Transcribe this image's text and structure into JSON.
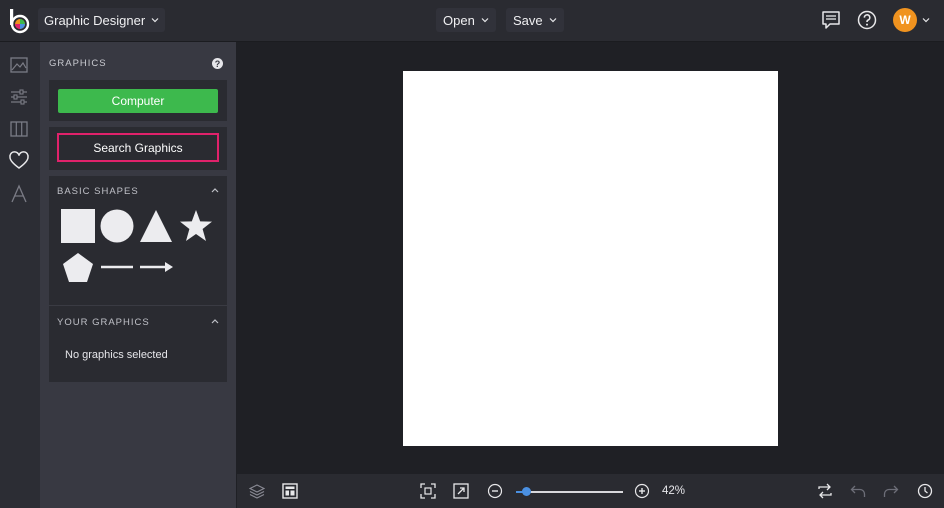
{
  "topbar": {
    "app_switcher_label": "Graphic Designer",
    "open_label": "Open",
    "save_label": "Save",
    "avatar_initial": "W"
  },
  "rail": {
    "items": [
      "image-icon",
      "sliders-icon",
      "columns-icon",
      "heart-icon",
      "text-icon"
    ]
  },
  "panel": {
    "title": "GRAPHICS",
    "computer_button": "Computer",
    "search_button": "Search Graphics",
    "basic_shapes": {
      "title": "BASIC SHAPES",
      "shapes": [
        "square",
        "circle",
        "triangle",
        "star",
        "pentagon",
        "line",
        "arrow"
      ]
    },
    "your_graphics": {
      "title": "YOUR GRAPHICS",
      "empty_text": "No graphics selected"
    }
  },
  "bottombar": {
    "zoom_label": "42%",
    "zoom_value": 0.1
  },
  "colors": {
    "accent_green": "#3db94d",
    "highlight_pink": "#e0226b",
    "avatar_orange": "#f0931f",
    "slider_blue": "#4a90e2"
  }
}
